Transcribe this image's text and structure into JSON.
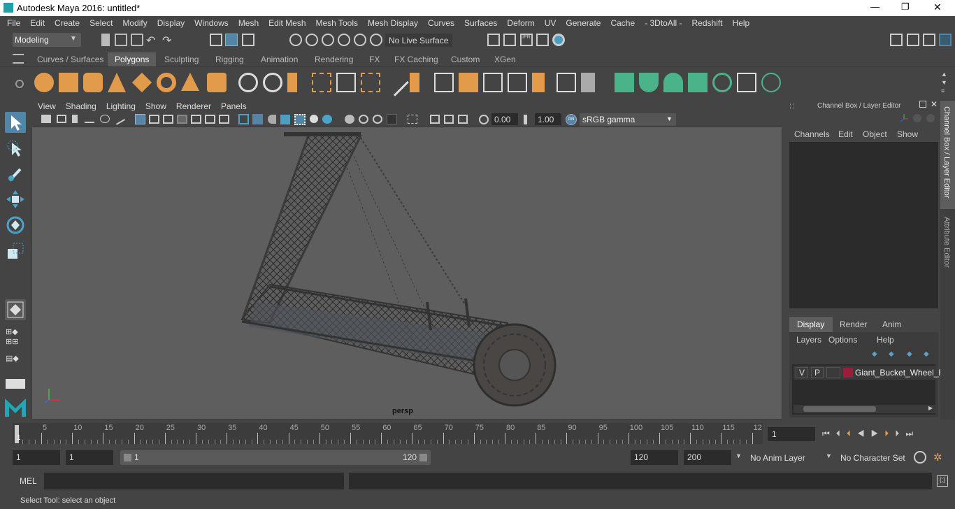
{
  "window": {
    "title": "Autodesk Maya 2016: untitled*",
    "min": "—",
    "max": "❐",
    "close": "✕"
  },
  "menu": [
    "File",
    "Edit",
    "Create",
    "Select",
    "Modify",
    "Display",
    "Windows",
    "Mesh",
    "Edit Mesh",
    "Mesh Tools",
    "Mesh Display",
    "Curves",
    "Surfaces",
    "Deform",
    "UV",
    "Generate",
    "Cache",
    "- 3DtoAll -",
    "Redshift",
    "Help"
  ],
  "status": {
    "mode": "Modeling",
    "live_surface": "No Live Surface"
  },
  "shelf_tabs": [
    "Curves / Surfaces",
    "Polygons",
    "Sculpting",
    "Rigging",
    "Animation",
    "Rendering",
    "FX",
    "FX Caching",
    "Custom",
    "XGen"
  ],
  "active_shelf_tab": "Polygons",
  "viewport": {
    "menu": [
      "View",
      "Shading",
      "Lighting",
      "Show",
      "Renderer",
      "Panels"
    ],
    "exposure": "0.00",
    "gamma": "1.00",
    "color_space": "sRGB gamma",
    "camera_label": "persp"
  },
  "channel_box": {
    "title": "Channel Box / Layer Editor",
    "menu": [
      "Channels",
      "Edit",
      "Object",
      "Show"
    ],
    "layer_tabs": [
      "Display",
      "Render",
      "Anim"
    ],
    "layer_menu": [
      "Layers",
      "Options",
      "Help"
    ],
    "layer": {
      "v": "V",
      "p": "P",
      "name": "Giant_Bucket_Wheel_E",
      "color": "#9a1e3a"
    }
  },
  "side_tabs": [
    "Channel Box / Layer Editor",
    "Attribute Editor"
  ],
  "timeline": {
    "ticks": [
      "5",
      "10",
      "15",
      "20",
      "25",
      "30",
      "35",
      "40",
      "45",
      "50",
      "55",
      "60",
      "65",
      "70",
      "75",
      "80",
      "85",
      "90",
      "95",
      "100",
      "105",
      "110",
      "115",
      "12"
    ],
    "start_tick": "1",
    "current_frame": "1"
  },
  "range": {
    "start": "1",
    "playback_start": "1",
    "slider_start": "1",
    "slider_end": "120",
    "end": "120",
    "anim_end": "200",
    "anim_layer": "No Anim Layer",
    "char_set": "No Character Set"
  },
  "mel": {
    "label": "MEL"
  },
  "help_line": "Select Tool: select an object",
  "colors": {
    "accent": "#5285a6",
    "bg": "#444444",
    "viewport": "#5e5e5e",
    "shelf_orange": "#e29a4b",
    "shelf_green": "#4ab38a"
  }
}
